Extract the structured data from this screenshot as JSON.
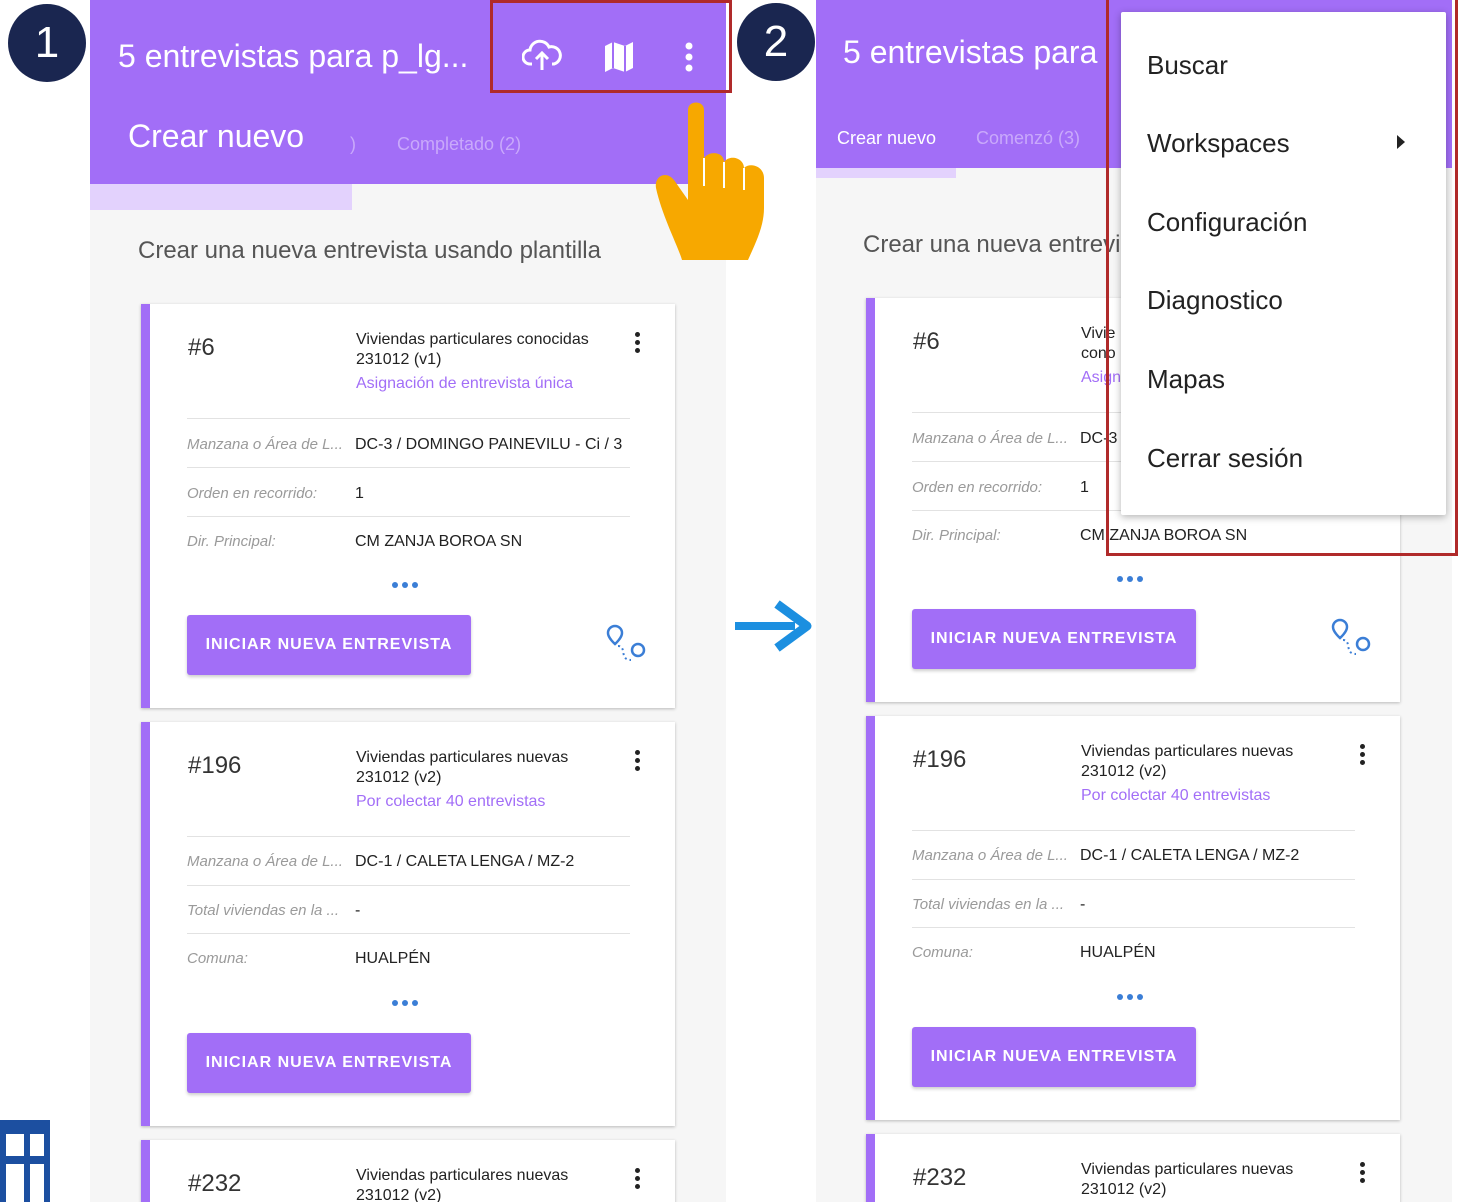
{
  "badges": {
    "step1": "1",
    "step2": "2"
  },
  "app": {
    "title_left": "5 entrevistas para p_lg...",
    "title_right": "5 entrevistas para"
  },
  "left_tabs": {
    "create": "Crear nuevo",
    "partial": ")",
    "completed": "Completado (2)"
  },
  "right_tabs": {
    "create": "Crear nuevo",
    "started": "Comenzó (3)"
  },
  "section_title_left": "Crear una nueva entrevista usando plantilla",
  "section_title_right": "Crear una nueva entrevi",
  "start_button": "INICIAR NUEVA ENTREVISTA",
  "cards": [
    {
      "number": "#6",
      "title": "Viviendas particulares conocidas 231012 (v1)",
      "subtitle": "Asignación de entrevista única",
      "fields": [
        {
          "label": "Manzana o Área de L...",
          "value": "DC-3 / DOMINGO PAINEVILU - Ci / 3"
        },
        {
          "label": "Orden en recorrido:",
          "value": "1"
        },
        {
          "label": "Dir. Principal:",
          "value": "CM ZANJA BOROA SN"
        }
      ]
    },
    {
      "number": "#196",
      "title": "Viviendas particulares nuevas 231012 (v2)",
      "subtitle": "Por colectar 40 entrevistas",
      "fields": [
        {
          "label": "Manzana o Área de L...",
          "value": "DC-1 / CALETA LENGA / MZ-2"
        },
        {
          "label": "Total viviendas en la ...",
          "value": "-"
        },
        {
          "label": "Comuna:",
          "value": "HUALPÉN"
        }
      ]
    },
    {
      "number": "#232",
      "title": "Viviendas particulares nuevas 231012 (v2)"
    }
  ],
  "right_card1_partial": {
    "title_frag": "Vivie cono",
    "subtitle_frag": "Asign",
    "value_frag": "DC-3",
    "dir_value": "CM ZANJA BOROA SN"
  },
  "menu": {
    "items": [
      "Buscar",
      "Workspaces",
      "Configuración",
      "Diagnostico",
      "Mapas",
      "Cerrar sesión"
    ]
  },
  "colors": {
    "primary": "#a26ef7",
    "badge": "#1a2650",
    "arrow": "#1c8fe0",
    "hand": "#f7a800",
    "highlight": "#b02a2a"
  },
  "icons": [
    "cloud-upload-icon",
    "map-icon",
    "more-vert-icon",
    "pointing-hand-icon",
    "arrow-right-icon",
    "route-icon",
    "chevron-right-icon"
  ]
}
